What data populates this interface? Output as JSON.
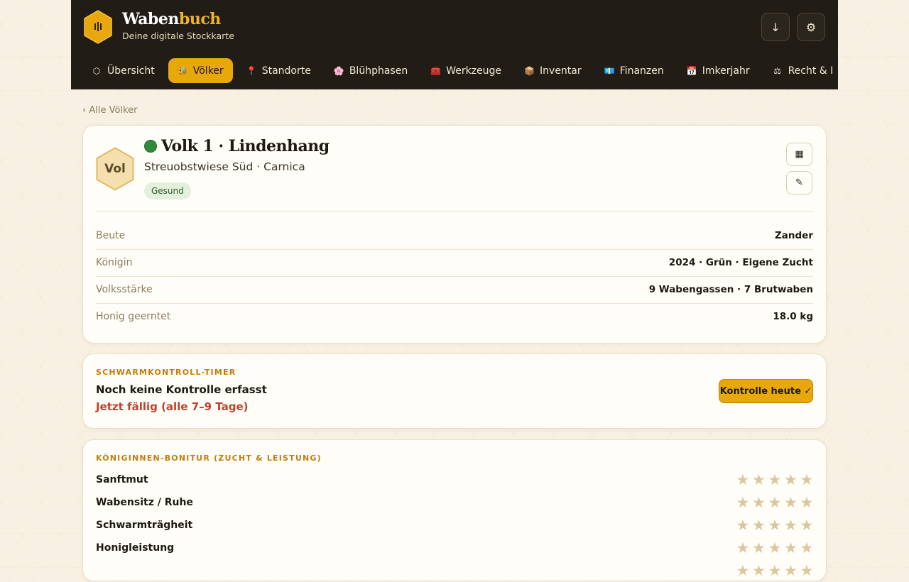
{
  "brand": {
    "title_main": "Waben",
    "title_accent": "buch",
    "subtitle": "Deine digitale Stockkarte"
  },
  "header": {
    "download_icon": "download-icon",
    "settings_icon": "gear-icon"
  },
  "nav": {
    "tabs": [
      {
        "label": "Übersicht",
        "icon": "⬡",
        "active": false
      },
      {
        "label": "Völker",
        "icon": "🐝",
        "active": true
      },
      {
        "label": "Standorte",
        "icon": "📍",
        "active": false
      },
      {
        "label": "Blühphasen",
        "icon": "🌸",
        "active": false
      },
      {
        "label": "Werkzeuge",
        "icon": "🧰",
        "active": false
      },
      {
        "label": "Inventar",
        "icon": "📦",
        "active": false
      },
      {
        "label": "Finanzen",
        "icon": "💶",
        "active": false
      },
      {
        "label": "Imkerjahr",
        "icon": "📅",
        "active": false
      },
      {
        "label": "Recht & I",
        "icon": "⚖",
        "active": false
      }
    ]
  },
  "back_link": "‹ Alle Völker",
  "colony": {
    "badge": "Vol",
    "name": "Volk 1 · Lindenhang",
    "subtitle": "Streuobstwiese Süd · Carnica",
    "status": "Gesund",
    "status_color": "#2f8a3c",
    "details": [
      {
        "key": "Beute",
        "value": "Zander"
      },
      {
        "key": "Königin",
        "value": "2024 · Grün · Eigene Zucht"
      },
      {
        "key": "Volksstärke",
        "value": "9 Wabengassen · 7 Brutwaben"
      },
      {
        "key": "Honig geerntet",
        "value": "18.0 kg"
      }
    ]
  },
  "swarm_timer": {
    "label": "SCHWARMKONTROLL-TIMER",
    "status": "Noch keine Kontrolle erfasst",
    "due": "Jetzt fällig (alle 7–9 Tage)",
    "button": "Kontrolle heute ✓"
  },
  "queen_rating": {
    "label": "KÖNIGINNEN-BONITUR (ZUCHT & LEISTUNG)",
    "max_stars": 5,
    "criteria": [
      {
        "label": "Sanftmut",
        "rating": 0
      },
      {
        "label": "Wabensitz / Ruhe",
        "rating": 0
      },
      {
        "label": "Schwarmträgheit",
        "rating": 0
      },
      {
        "label": "Honigleistung",
        "rating": 0
      },
      {
        "label": "",
        "rating": 0
      }
    ]
  },
  "colors": {
    "accent": "#e8a80c",
    "header_bg": "#211d16",
    "due_red": "#c2402e",
    "section_label": "#c27d0e"
  }
}
